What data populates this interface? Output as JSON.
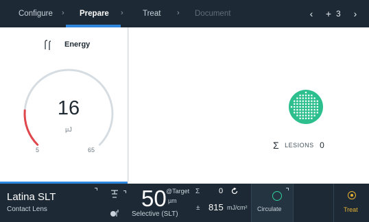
{
  "nav": {
    "steps": [
      "Configure",
      "Prepare",
      "Treat",
      "Document"
    ],
    "separator": "›",
    "prev_label": "‹",
    "next_label": "›",
    "crosshair_glyph": "+",
    "count": "3"
  },
  "energy": {
    "title": "Energy",
    "value": "16",
    "unit": "µJ",
    "min": "5",
    "max": "65",
    "gauge_fraction": 0.183
  },
  "lesions": {
    "sigma": "Σ",
    "label": "LESIONS",
    "count": "0"
  },
  "lens": {
    "name": "Latina SLT",
    "subtitle": "Contact Lens"
  },
  "pattern": {
    "value": "50",
    "at_target": "@Target",
    "unit": "µm",
    "mode": "Selective (SLT)"
  },
  "counters": {
    "sigma": "Σ",
    "count": "0",
    "pm": "±",
    "fluence": "815",
    "fluence_unit": "mJ/cm²"
  },
  "circulate": {
    "label": "Circulate"
  },
  "treat": {
    "label": "Treat"
  },
  "colors": {
    "accent_blue": "#2f88e0",
    "bar_dark": "#1d2a35",
    "gauge_red": "#e0474c",
    "gauge_track": "#d6dde2",
    "lesion_green": "#2dbf8e",
    "treat_yellow": "#e8b233"
  },
  "icons": {
    "energy": "energy-gauge-icon",
    "reset": "reset-icon",
    "circulate": "circle-icon",
    "treat": "target-icon"
  }
}
